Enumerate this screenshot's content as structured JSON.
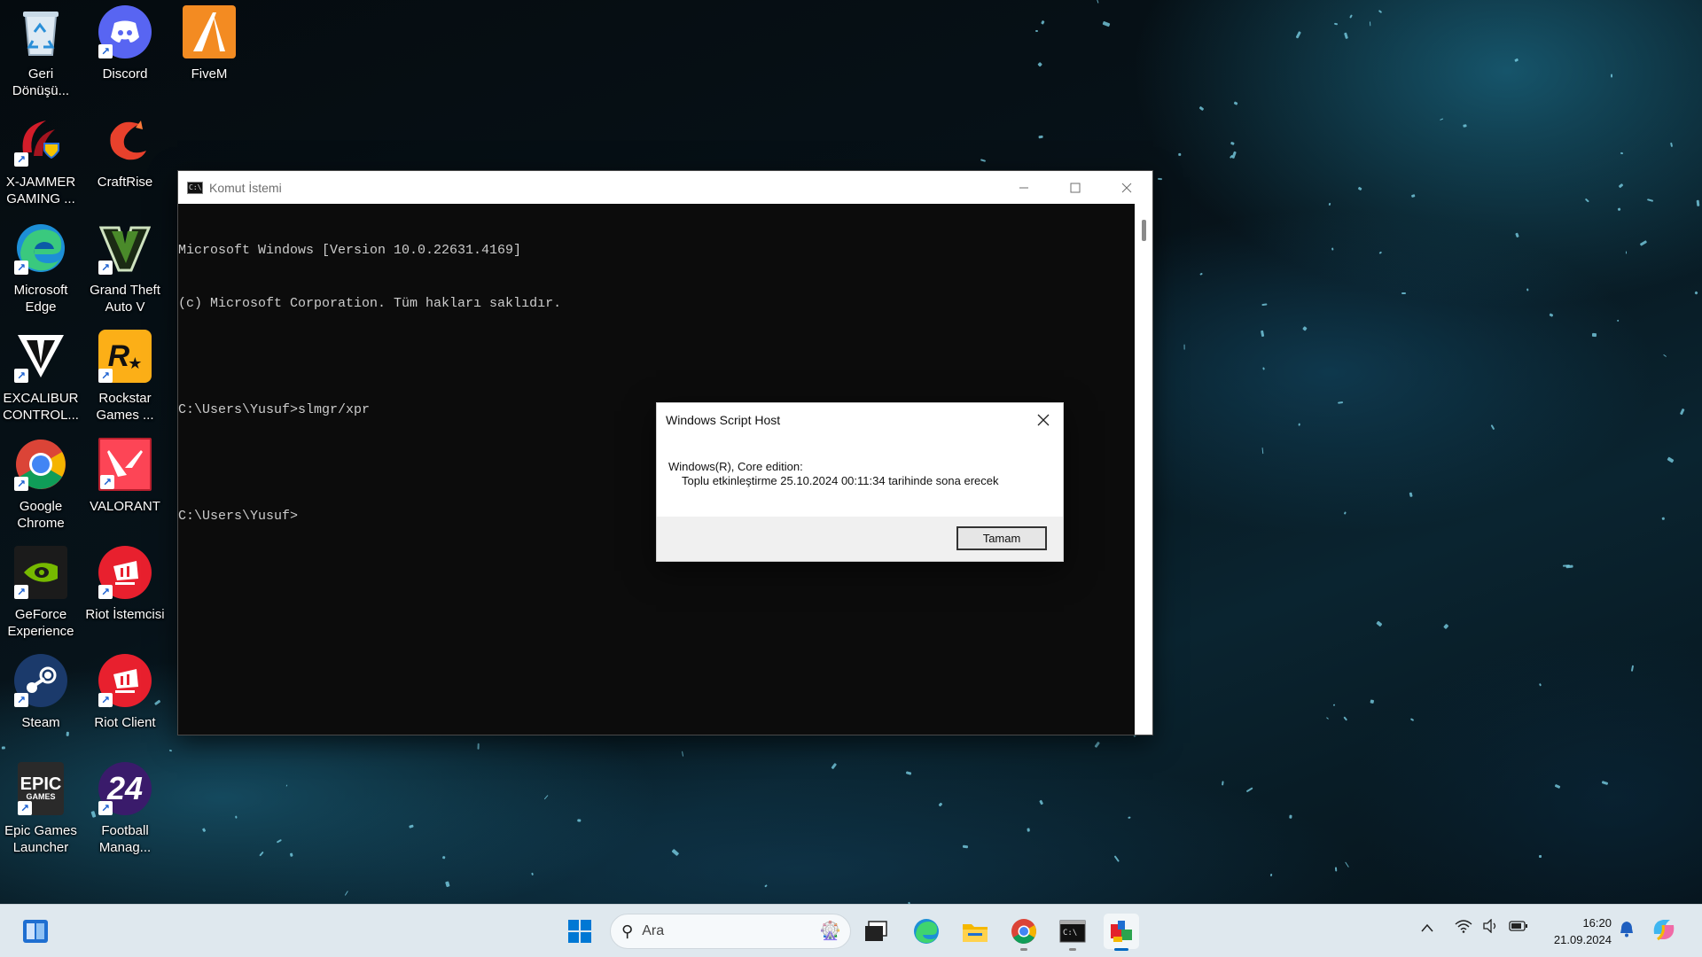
{
  "desktop": {
    "icons": [
      {
        "label": "Geri Dönüşü...",
        "icon": "recycle-bin-icon"
      },
      {
        "label": "Discord",
        "icon": "discord-icon"
      },
      {
        "label": "FiveM",
        "icon": "fivem-icon"
      },
      {
        "label": "X-JAMMER GAMING ...",
        "icon": "xjammer-icon"
      },
      {
        "label": "CraftRise",
        "icon": "craftrise-icon"
      },
      {
        "label": "Microsoft Edge",
        "icon": "edge-icon"
      },
      {
        "label": "Grand Theft Auto V",
        "icon": "gta-icon"
      },
      {
        "label": "EXCALIBUR CONTROL...",
        "icon": "excalibur-icon"
      },
      {
        "label": "Rockstar Games ...",
        "icon": "rockstar-icon"
      },
      {
        "label": "Google Chrome",
        "icon": "chrome-icon"
      },
      {
        "label": "VALORANT",
        "icon": "valorant-icon"
      },
      {
        "label": "GeForce Experience",
        "icon": "geforce-icon"
      },
      {
        "label": "Riot İstemcisi",
        "icon": "riot-icon"
      },
      {
        "label": "Steam",
        "icon": "steam-icon"
      },
      {
        "label": "Riot Client",
        "icon": "riot-icon"
      },
      {
        "label": "Epic Games Launcher",
        "icon": "epic-icon"
      },
      {
        "label": "Football Manag...",
        "icon": "football-manager-icon"
      }
    ]
  },
  "cmd_window": {
    "title": "Komut İstemi",
    "lines": [
      "Microsoft Windows [Version 10.0.22631.4169]",
      "(c) Microsoft Corporation. Tüm hakları saklıdır.",
      "",
      "C:\\Users\\Yusuf>slmgr/xpr",
      "",
      "C:\\Users\\Yusuf>"
    ]
  },
  "dialog": {
    "title": "Windows Script Host",
    "line1": "Windows(R), Core edition:",
    "line2": "Toplu etkinleştirme 25.10.2024 00:11:34 tarihinde sona erecek",
    "ok_label": "Tamam"
  },
  "taskbar": {
    "search_placeholder": "Ara",
    "time": "16:20",
    "date": "21.09.2024",
    "accent_color": "#0067c0"
  }
}
